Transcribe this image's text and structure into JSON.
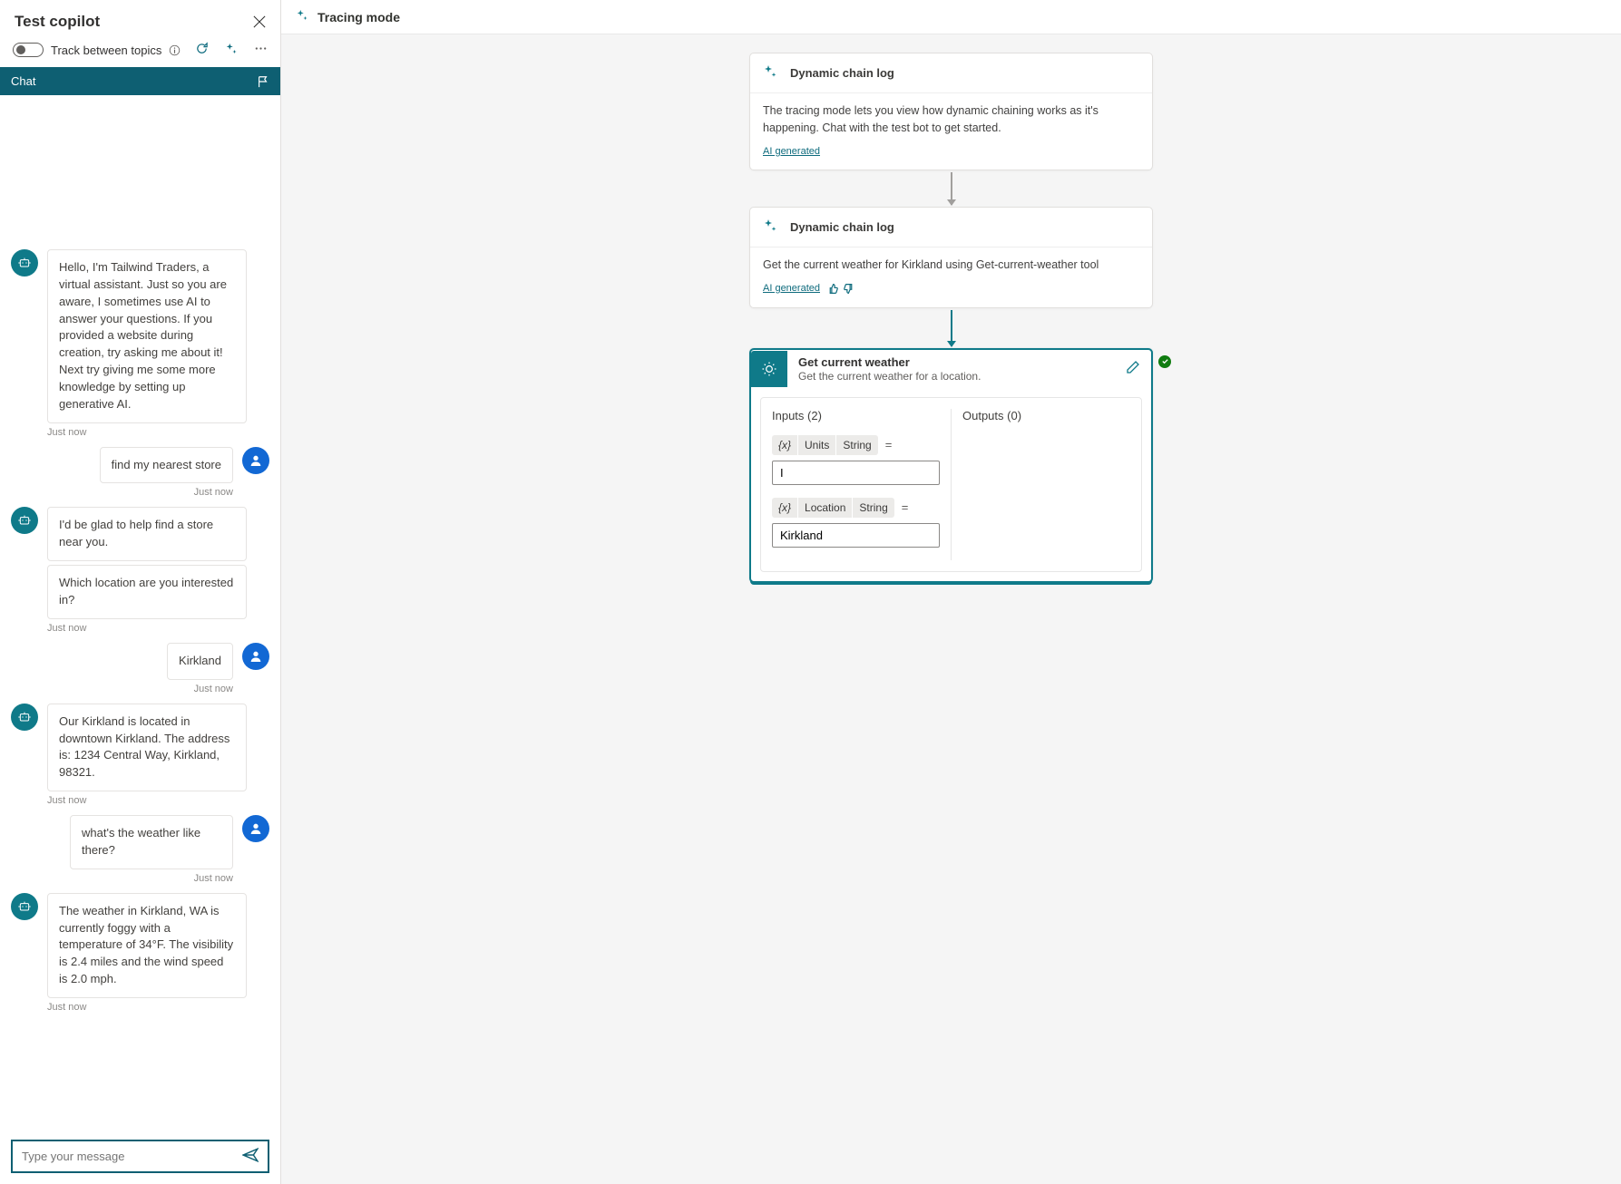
{
  "leftPanel": {
    "title": "Test copilot",
    "toggleLabel": "Track between topics",
    "chatTab": "Chat",
    "messages": [
      {
        "role": "bot",
        "text": "Hello, I'm Tailwind Traders, a virtual assistant. Just so you are aware, I sometimes use AI to answer your questions. If you provided a website during creation, try asking me about it! Next try giving me some more knowledge by setting up generative AI.",
        "ts": "Just now"
      },
      {
        "role": "user",
        "text": "find my nearest store",
        "ts": "Just now"
      },
      {
        "role": "bot",
        "text": "I'd be glad to help find a store near you."
      },
      {
        "role": "bot",
        "text": "Which location are you interested in?",
        "ts": "Just now"
      },
      {
        "role": "user",
        "text": "Kirkland",
        "ts": "Just now"
      },
      {
        "role": "bot",
        "text": "Our Kirkland is located in downtown Kirkland. The address is: 1234 Central Way, Kirkland, 98321.",
        "ts": "Just now"
      },
      {
        "role": "user",
        "text": "what's the weather like there?",
        "ts": "Just now"
      },
      {
        "role": "bot",
        "text": "The weather in Kirkland, WA is currently foggy with a temperature of 34°F. The visibility is 2.4 miles and the wind speed is 2.0 mph.",
        "ts": "Just now"
      }
    ],
    "inputPlaceholder": "Type your message"
  },
  "rightPanel": {
    "title": "Tracing mode",
    "nodes": {
      "n1": {
        "title": "Dynamic chain log",
        "body": "The tracing mode lets you view how dynamic chaining works as it's happening. Chat with the test bot to get started.",
        "aiGen": "AI generated"
      },
      "n2": {
        "title": "Dynamic chain log",
        "body": "Get the current weather for Kirkland using Get-current-weather tool",
        "aiGen": "AI generated"
      },
      "tool": {
        "title": "Get current weather",
        "subtitle": "Get the current weather for a location.",
        "inputsLabel": "Inputs (2)",
        "outputsLabel": "Outputs (0)",
        "varPrefix": "{x}",
        "params": [
          {
            "name": "Units",
            "type": "String",
            "value": "I"
          },
          {
            "name": "Location",
            "type": "String",
            "value": "Kirkland"
          }
        ]
      }
    }
  }
}
